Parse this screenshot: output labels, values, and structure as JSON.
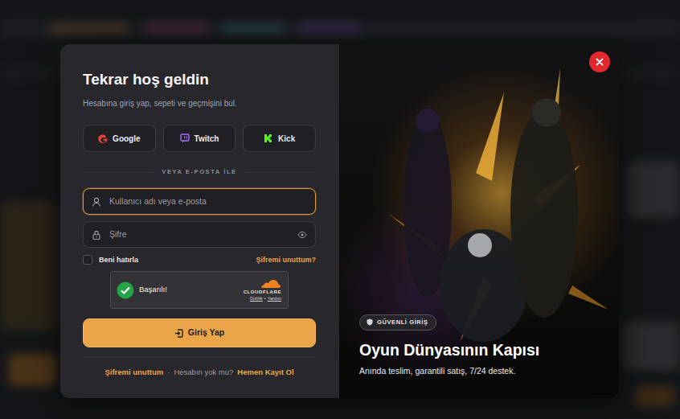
{
  "login": {
    "title": "Tekrar hoş geldin",
    "subtitle": "Hesabına giriş yap, sepeti ve geçmişini bul.",
    "social_buttons": [
      {
        "label": "Google"
      },
      {
        "label": "Twitch"
      },
      {
        "label": "Kick"
      }
    ],
    "divider": "VEYA E-POSTA İLE",
    "fields": [
      {
        "placeholder": "Kullanıcı adı veya e-posta",
        "kind": "text",
        "focused": true
      },
      {
        "placeholder": "Şifre",
        "kind": "password",
        "focused": false
      }
    ],
    "remember": {
      "label": "Beni hatırla",
      "checked": false
    },
    "forgot_link": "Şifremi unuttum?",
    "captcha": {
      "status": "Başarılı!",
      "brand": "CLOUDFLARE",
      "links": [
        "Gizlilik",
        "Yardım"
      ],
      "separator": "•"
    },
    "submit": "Giriş Yap",
    "footer": {
      "forgot": "Şifremi unuttum",
      "separator": "·",
      "question": "Hesabın yok mu?",
      "register": "Hemen Kayıt Ol"
    }
  },
  "hero": {
    "badge": "GÜVENLİ GİRİŞ",
    "title": "Oyun Dünyasının Kapısı",
    "subtitle": "Anında teslim, garantili satış, 7/24 destek."
  }
}
